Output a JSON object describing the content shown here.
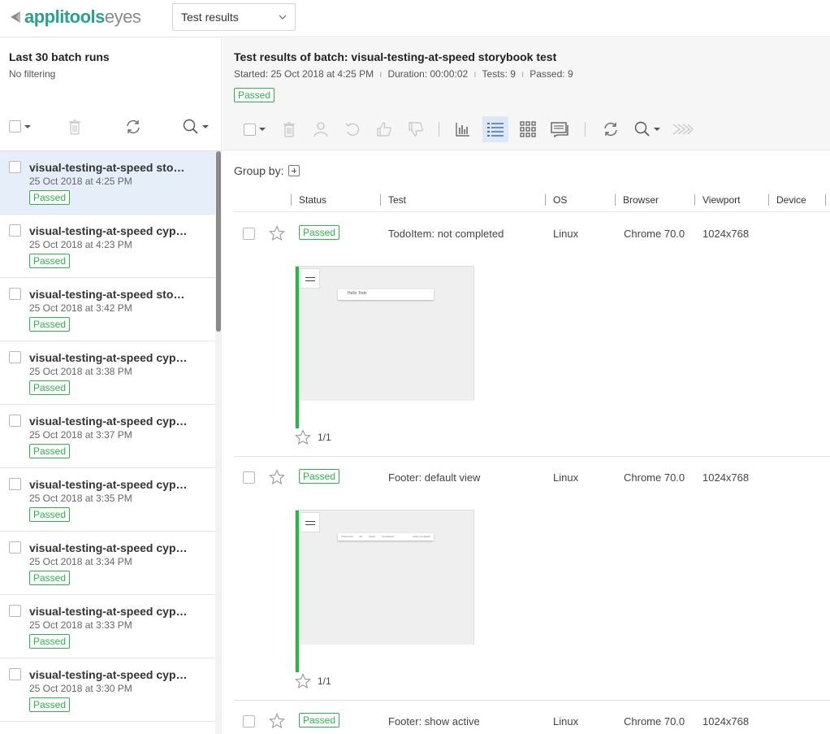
{
  "header": {
    "logo_brand": "applitools",
    "logo_product": "eyes",
    "view_select": "Test results"
  },
  "sidebar": {
    "title": "Last 30 batch runs",
    "filter": "No filtering",
    "batches": [
      {
        "name": "visual-testing-at-speed storybook test",
        "date": "25 Oct 2018 at 4:25 PM",
        "status": "Passed"
      },
      {
        "name": "visual-testing-at-speed cypress test",
        "date": "25 Oct 2018 at 4:23 PM",
        "status": "Passed"
      },
      {
        "name": "visual-testing-at-speed storybook test",
        "date": "25 Oct 2018 at 3:42 PM",
        "status": "Passed"
      },
      {
        "name": "visual-testing-at-speed cypress test",
        "date": "25 Oct 2018 at 3:38 PM",
        "status": "Passed"
      },
      {
        "name": "visual-testing-at-speed cypress test",
        "date": "25 Oct 2018 at 3:37 PM",
        "status": "Passed"
      },
      {
        "name": "visual-testing-at-speed cypress test",
        "date": "25 Oct 2018 at 3:35 PM",
        "status": "Passed"
      },
      {
        "name": "visual-testing-at-speed cypress test",
        "date": "25 Oct 2018 at 3:34 PM",
        "status": "Passed"
      },
      {
        "name": "visual-testing-at-speed cypress test",
        "date": "25 Oct 2018 at 3:33 PM",
        "status": "Passed"
      },
      {
        "name": "visual-testing-at-speed cypress test",
        "date": "25 Oct 2018 at 3:30 PM",
        "status": "Passed"
      }
    ]
  },
  "batch": {
    "title": "Test results of batch: visual-testing-at-speed storybook test",
    "started": "Started: 25 Oct 2018 at 4:25 PM",
    "duration": "Duration: 00:00:02",
    "tests": "Tests: 9",
    "passed": "Passed: 9",
    "status": "Passed"
  },
  "group_by_label": "Group by:",
  "columns": [
    "Status",
    "Test",
    "OS",
    "Browser",
    "Viewport",
    "Device"
  ],
  "results": [
    {
      "status": "Passed",
      "test": "TodoItem: not completed",
      "os": "Linux",
      "browser": "Chrome 70.0",
      "viewport": "1024x768",
      "step": "1/1",
      "thumb_text": "Hello Todo"
    },
    {
      "status": "Passed",
      "test": "Footer: default view",
      "os": "Linux",
      "browser": "Chrome 70.0",
      "viewport": "1024x768",
      "step": "1/1",
      "thumb_foot": [
        "0 items left",
        "All",
        "Active",
        "Completed",
        "Clear completed"
      ]
    },
    {
      "status": "Passed",
      "test": "Footer: show active",
      "os": "Linux",
      "browser": "Chrome 70.0",
      "viewport": "1024x768"
    }
  ],
  "colors": {
    "brand": "#2aa090",
    "passed": "#2eb34a",
    "selected_row": "#e6eefa",
    "active_tool": "#dde8f7"
  }
}
